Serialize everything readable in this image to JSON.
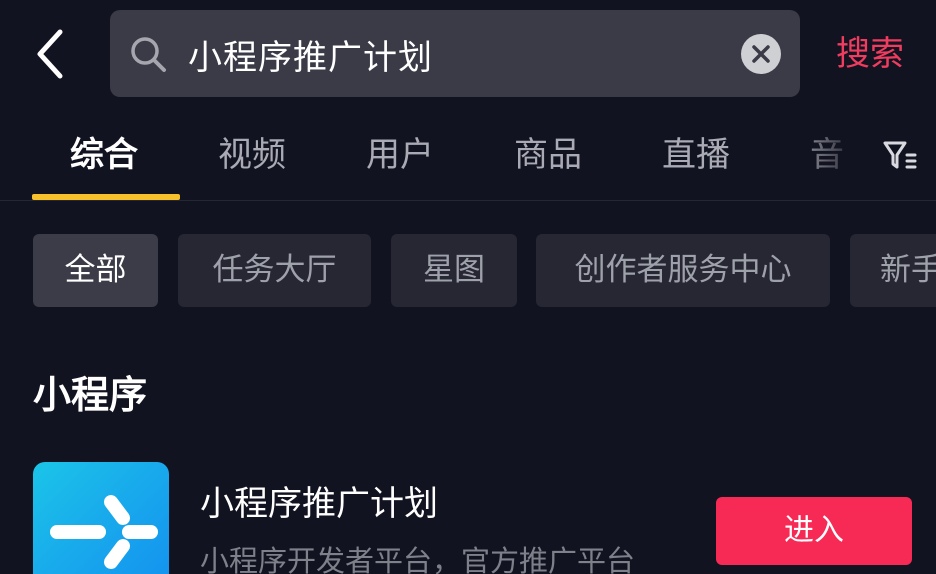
{
  "colors": {
    "background": "#121320",
    "search_box": "#3a3b47",
    "accent_red": "#f03d5f",
    "tab_underline": "#f7c12b",
    "enter_button": "#f62a55",
    "logo_blue": "#18a8ec"
  },
  "header": {
    "back_icon": "chevron-left-icon",
    "search_icon": "search-icon",
    "query": "小程序推广计划",
    "clear_icon": "close-circle-icon",
    "submit_label": "搜索"
  },
  "tabs": [
    {
      "label": "综合",
      "active": true
    },
    {
      "label": "视频",
      "active": false
    },
    {
      "label": "用户",
      "active": false
    },
    {
      "label": "商品",
      "active": false
    },
    {
      "label": "直播",
      "active": false
    },
    {
      "label": "音",
      "active": false
    }
  ],
  "filter_icon": "filter-icon",
  "chips": [
    {
      "label": "全部",
      "active": true
    },
    {
      "label": "任务大厅",
      "active": false
    },
    {
      "label": "星图",
      "active": false
    },
    {
      "label": "创作者服务中心",
      "active": false
    },
    {
      "label": "新手",
      "active": false
    }
  ],
  "section": {
    "title": "小程序"
  },
  "result": {
    "logo_icon": "mini-program-logo-icon",
    "name": "小程序推广计划",
    "description": "小程序开发者平台，官方推广平台",
    "action_label": "进入"
  }
}
